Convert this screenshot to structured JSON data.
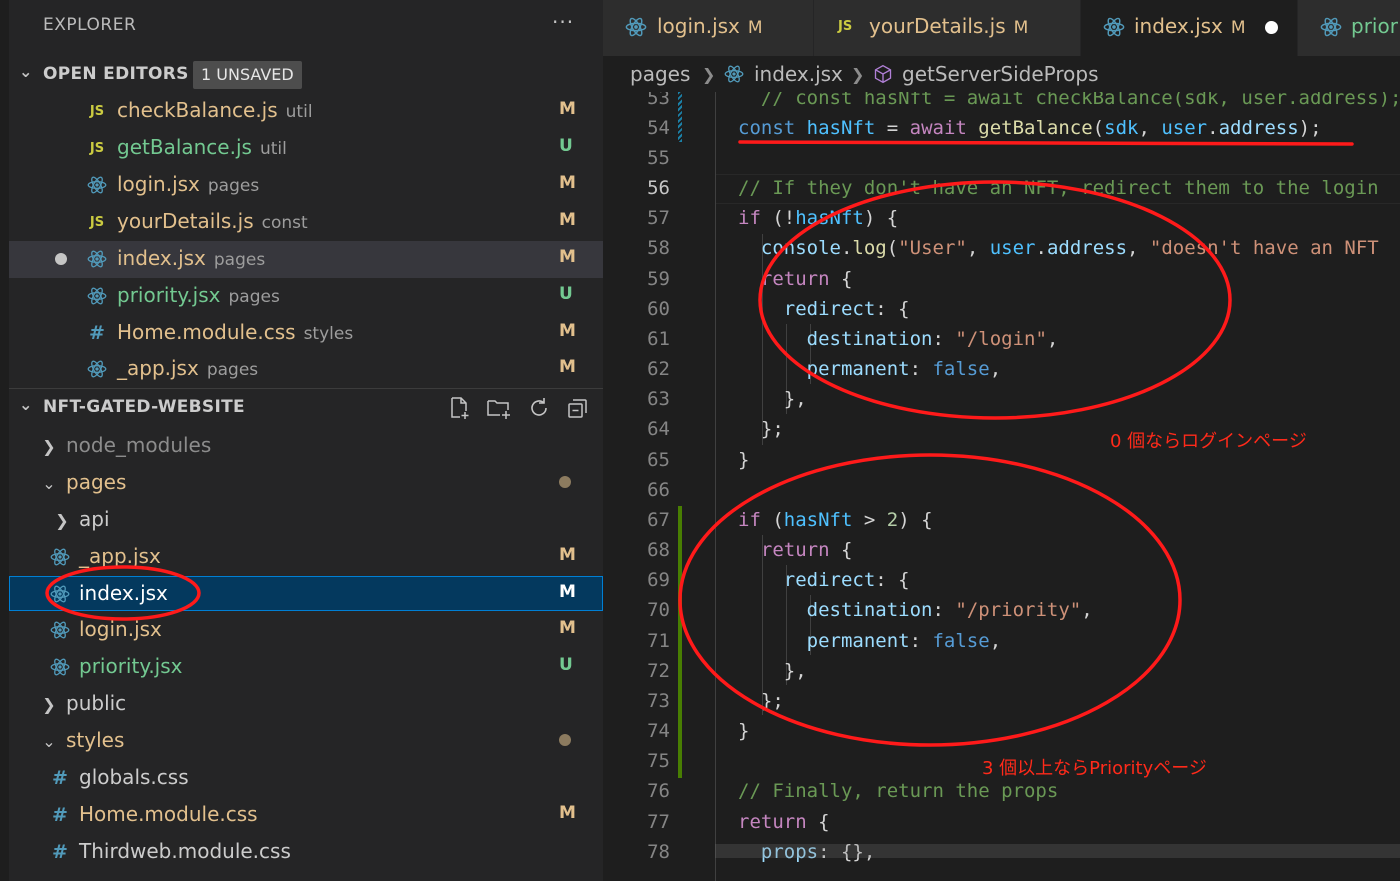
{
  "sidebar": {
    "title": "EXPLORER",
    "more_label": "···",
    "open_editors": {
      "header": "OPEN EDITORS",
      "badge": "1 UNSAVED",
      "files": [
        {
          "name": "checkBalance.js",
          "dir": "util",
          "icon": "js-icon",
          "status": "M"
        },
        {
          "name": "getBalance.js",
          "dir": "util",
          "icon": "js-icon",
          "status": "U"
        },
        {
          "name": "login.jsx",
          "dir": "pages",
          "icon": "react-icon",
          "status": "M"
        },
        {
          "name": "yourDetails.js",
          "dir": "const",
          "icon": "js-icon",
          "status": "M"
        },
        {
          "name": "index.jsx",
          "dir": "pages",
          "icon": "react-icon",
          "status": "M"
        },
        {
          "name": "priority.jsx",
          "dir": "pages",
          "icon": "react-icon",
          "status": "U"
        },
        {
          "name": "Home.module.css",
          "dir": "styles",
          "icon": "css-hash-icon",
          "status": "M"
        },
        {
          "name": "_app.jsx",
          "dir": "pages",
          "icon": "react-icon",
          "status": "M"
        }
      ]
    },
    "project": {
      "header": "NFT-GATED-WEBSITE",
      "tree": [
        {
          "name": "node_modules",
          "type": "folder-collapsed"
        },
        {
          "name": "pages",
          "type": "folder-expanded"
        },
        {
          "name": "api",
          "type": "folder-collapsed"
        },
        {
          "name": "_app.jsx",
          "type": "file",
          "status": "M"
        },
        {
          "name": "index.jsx",
          "type": "file",
          "status": "M"
        },
        {
          "name": "login.jsx",
          "type": "file",
          "status": "M"
        },
        {
          "name": "priority.jsx",
          "type": "file",
          "status": "U"
        },
        {
          "name": "public",
          "type": "folder-collapsed"
        },
        {
          "name": "styles",
          "type": "folder-expanded"
        },
        {
          "name": "globals.css",
          "type": "file"
        },
        {
          "name": "Home.module.css",
          "type": "file",
          "status": "M"
        },
        {
          "name": "Thirdweb.module.css",
          "type": "file"
        }
      ]
    }
  },
  "tabs": [
    {
      "label": "login.jsx",
      "status": "M",
      "icon": "react-icon"
    },
    {
      "label": "yourDetails.js",
      "status": "M",
      "icon": "js-icon"
    },
    {
      "label": "index.jsx",
      "status": "M",
      "icon": "react-icon",
      "active": true
    },
    {
      "label": "prior",
      "icon": "react-icon"
    }
  ],
  "breadcrumb": {
    "folder": "pages",
    "file": "index.jsx",
    "symbol": "getServerSideProps"
  },
  "editor": {
    "line_numbers": [
      "53",
      "54",
      "55",
      "56",
      "57",
      "58",
      "59",
      "60",
      "61",
      "62",
      "63",
      "64",
      "65",
      "66",
      "67",
      "68",
      "69",
      "70",
      "71",
      "72",
      "73",
      "74",
      "75",
      "76",
      "77",
      "78"
    ],
    "current_line": "56",
    "code": {
      "l53": "  // const hasNft = await checkBalance(sdk, user.address);",
      "l54_const": "const",
      "l54_var": "hasNft",
      "l54_await": "await",
      "l54_fn": "getBalance",
      "l54_sdk": "sdk",
      "l54_user": "user",
      "l54_addr": "address",
      "l56": "// If they don't have an NFT, redirect them to the login",
      "l57_if": "if",
      "l57_var": "hasNft",
      "l58_console": "console",
      "l58_log": "log",
      "l58_str1": "\"User\"",
      "l58_user": "user",
      "l58_addr": "address",
      "l58_str2": "\"doesn't have an NFT",
      "return_kw": "return",
      "redirect_prop": "redirect",
      "destination_prop": "destination",
      "permanent_prop": "permanent",
      "false_kw": "false",
      "l61_str": "\"/login\"",
      "l67_if": "if",
      "l67_var": "hasNft",
      "l67_num": "2",
      "l70_str": "\"/priority\"",
      "l76": "// Finally, return the props",
      "props_prop": "props"
    }
  },
  "annotations": {
    "login_note": "0 個ならログインページ",
    "priority_note": "3 個以上ならPriorityページ"
  },
  "colors": {
    "annotation": "#ff1a1a",
    "modified": "#e2c08d",
    "untracked": "#73c991"
  }
}
